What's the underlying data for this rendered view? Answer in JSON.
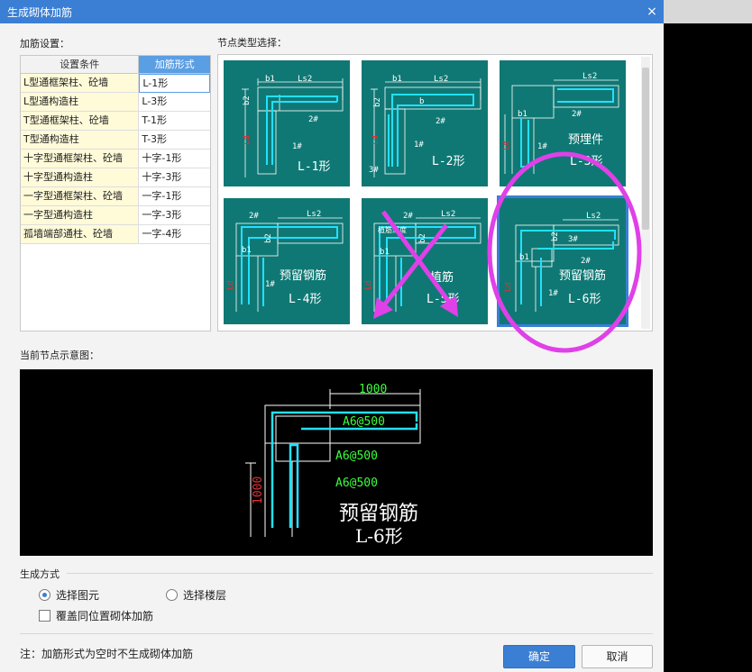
{
  "window": {
    "title": "生成砌体加筋",
    "close_glyph": "×"
  },
  "sections": {
    "rebar_settings": "加筋设置：",
    "node_type": "节点类型选择：",
    "current_node": "当前节点示意图：",
    "gen_method": "生成方式"
  },
  "table": {
    "headers": [
      "设置条件",
      "加筋形式"
    ],
    "rows": [
      [
        "L型通框架柱、砼墙",
        "L-1形"
      ],
      [
        "L型通构造柱",
        "L-3形"
      ],
      [
        "T型通框架柱、砼墙",
        "T-1形"
      ],
      [
        "T型通构造柱",
        "T-3形"
      ],
      [
        "十字型通框架柱、砼墙",
        "十字-1形"
      ],
      [
        "十字型通构造柱",
        "十字-3形"
      ],
      [
        "一字型通框架柱、砼墙",
        "一字-1形"
      ],
      [
        "一字型通构造柱",
        "一字-3形"
      ],
      [
        "孤墙端部通柱、砼墙",
        "一字-4形"
      ]
    ]
  },
  "tiles": [
    {
      "name": "L-1形",
      "extra": "",
      "labels": [
        "b1",
        "Ls2",
        "b2",
        "2#",
        "1#",
        "Ld"
      ]
    },
    {
      "name": "L-2形",
      "extra": "",
      "labels": [
        "b1",
        "Ls2",
        "b2",
        "b",
        "2#",
        "1#",
        "3#",
        "Ld"
      ]
    },
    {
      "name": "L-3形",
      "extra": "预埋件",
      "labels": [
        "Ls2",
        "b1",
        "2#",
        "1#",
        "Ld"
      ]
    },
    {
      "name": "L-4形",
      "extra": "预留钢筋",
      "labels": [
        "2#",
        "Ls2",
        "b2",
        "b1",
        "1#",
        "Ld"
      ]
    },
    {
      "name": "L-5形",
      "extra": "植筋",
      "labels": [
        "2#",
        "Ls2",
        "b2",
        "b1",
        "植筋深度",
        "Ld"
      ]
    },
    {
      "name": "L-6形",
      "extra": "预留钢筋",
      "labels": [
        "Ls2",
        "3#",
        "2#",
        "b2",
        "b1",
        "1#",
        "Ld"
      ]
    }
  ],
  "preview": {
    "dim_top": "1000",
    "dim_left": "1000",
    "spec1": "A6@500",
    "spec2": "A6@500",
    "spec3": "A6@500",
    "caption1": "预留钢筋",
    "caption2": "L-6形"
  },
  "options": {
    "radio1": "选择图元",
    "radio2": "选择楼层",
    "radio_selected": "选择图元",
    "checkbox": "覆盖同位置砌体加筋"
  },
  "note": "注：加筋形式为空时不生成砌体加筋",
  "buttons": {
    "ok": "确定",
    "cancel": "取消"
  },
  "colors": {
    "title_bar": "#3b7fd4",
    "tile_bg": "#0f7874",
    "rebar": "#22e0ff",
    "spec_text": "#3cff3c",
    "dim_red": "#e03030",
    "annotation": "#e040e8"
  }
}
